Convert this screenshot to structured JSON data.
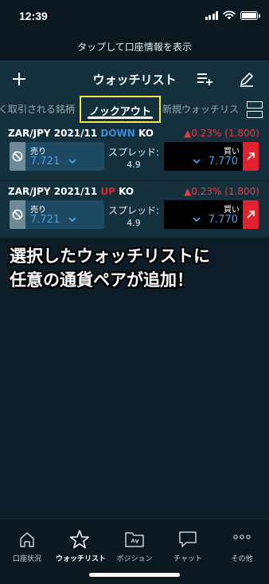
{
  "status_bar": {
    "time": "12:39"
  },
  "account_bar": {
    "text": "タップして口座情報を表示"
  },
  "header": {
    "title": "ウォッチリスト"
  },
  "tabs": {
    "left_partial": "よく取引される銘柄",
    "active": "ノックアウト",
    "right_partial": "新規ウォッチリスト"
  },
  "rows": [
    {
      "pair": "ZAR/JPY 2021/11",
      "direction": "DOWN",
      "suffix": "KO",
      "change": "▲0.23% (1.800)",
      "sell_label": "売り",
      "sell_price": "7.721",
      "spread_label": "スプレッド:",
      "spread_value": "4.9",
      "buy_label": "買い",
      "buy_price": "7.770"
    },
    {
      "pair": "ZAR/JPY 2021/11",
      "direction": "UP",
      "suffix": "KO",
      "change": "▲0.23% (1.800)",
      "sell_label": "売り",
      "sell_price": "7.721",
      "spread_label": "スプレッド:",
      "spread_value": "4.9",
      "buy_label": "買い",
      "buy_price": "7.770"
    }
  ],
  "annotation": {
    "line1": "選択したウォッチリストに",
    "line2": "任意の通貨ペアが追加！"
  },
  "bottom_nav": [
    {
      "label": "口座状況",
      "icon": "home-icon"
    },
    {
      "label": "ウォッチリスト",
      "icon": "star-icon",
      "active": true
    },
    {
      "label": "ポジション",
      "icon": "folder-icon"
    },
    {
      "label": "チャット",
      "icon": "chat-icon"
    },
    {
      "label": "その他",
      "icon": "more-icon"
    }
  ],
  "colors": {
    "background": "#0d1d27",
    "panel": "#14303d",
    "down": "#3c8cd8",
    "up": "#e0232f",
    "highlight": "#f2e94c"
  }
}
